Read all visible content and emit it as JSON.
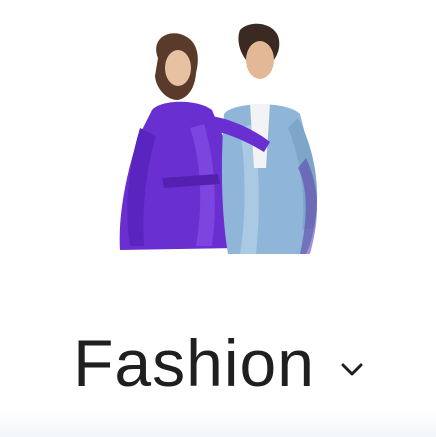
{
  "category": {
    "label": "Fashion",
    "image_icon": "fashion-models-image",
    "expand_icon": "chevron-down-icon"
  },
  "colors": {
    "dress": "#6a2fd0",
    "text": "#1f1f1f",
    "denim": "#8fb6d8"
  }
}
